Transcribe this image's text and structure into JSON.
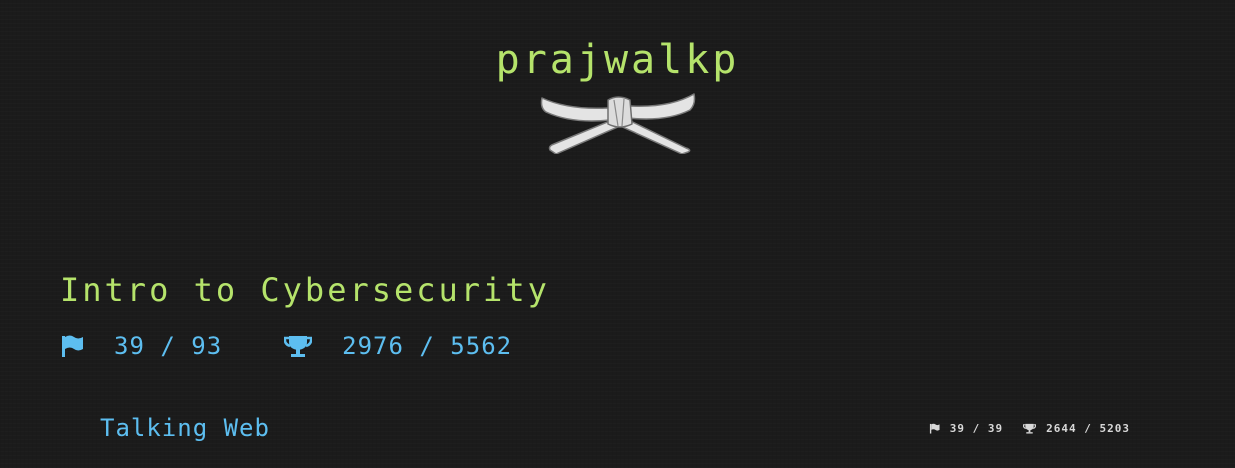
{
  "profile": {
    "username": "prajwalkp",
    "belt_icon": "white-belt-icon"
  },
  "course": {
    "title": "Intro to Cybersecurity",
    "flags_label": "39 / 93",
    "points_label": "2976 / 5562",
    "flag_icon": "flag-icon",
    "points_icon": "trophy-icon"
  },
  "modules": [
    {
      "name": "Talking Web",
      "flags_label": "39 / 39",
      "points_label": "2644 / 5203"
    }
  ],
  "colors": {
    "background": "#1b1b1b",
    "accent_green": "#b5e36b",
    "accent_blue": "#5dbef0",
    "muted_text": "#d8d8d8",
    "belt": "#e4e4e4"
  }
}
